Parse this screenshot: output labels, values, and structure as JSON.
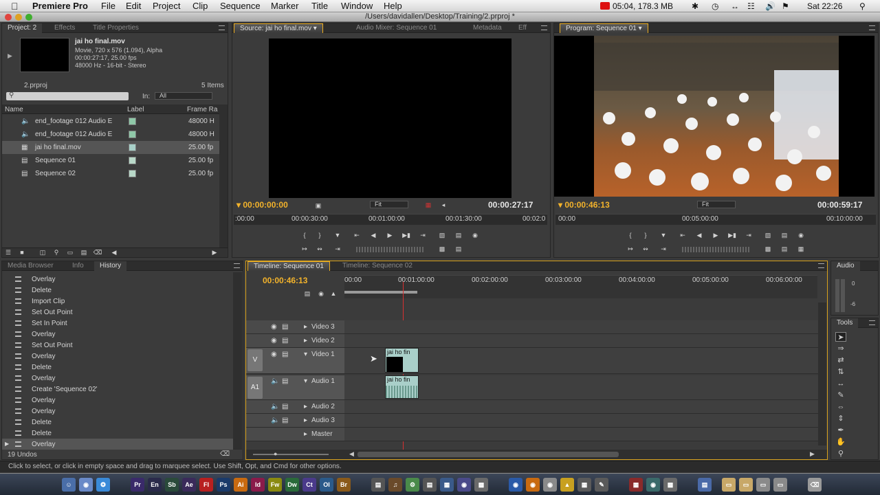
{
  "menubar": {
    "app": "Premiere Pro",
    "items": [
      "File",
      "Edit",
      "Project",
      "Clip",
      "Sequence",
      "Marker",
      "Title",
      "Window",
      "Help"
    ],
    "record_status": "05:04, 178.3 MB",
    "clock": "Sat 22:26"
  },
  "window": {
    "title": "/Users/davidallen/Desktop/Training/2.prproj *"
  },
  "project_panel": {
    "tabs": [
      "Project: 2",
      "Effects",
      "Title Properties"
    ],
    "clip_name": "jai ho final.mov",
    "clip_info": [
      "Movie, 720 x 576 (1.094), Alpha",
      "00:00:27:17, 25.00 fps",
      "48000 Hz - 16-bit - Stereo"
    ],
    "project_file": "2.prproj",
    "item_count": "5 Items",
    "in_label": "In:",
    "in_value": "All",
    "columns": [
      "Name",
      "Label",
      "Frame Ra"
    ],
    "items": [
      {
        "name": "end_footage 012 Audio E",
        "label_color": "#8fc8a8",
        "rate": "48000 H"
      },
      {
        "name": "end_footage 012 Audio E",
        "label_color": "#8fc8a8",
        "rate": "48000 H"
      },
      {
        "name": "jai ho final.mov",
        "label_color": "#a8d0c8",
        "rate": "25.00 fp"
      },
      {
        "name": "Sequence 01",
        "label_color": "#b8d8c8",
        "rate": "25.00 fp"
      },
      {
        "name": "Sequence 02",
        "label_color": "#b8d8c8",
        "rate": "25.00 fp"
      }
    ]
  },
  "source_monitor": {
    "tabs": [
      "Source: jai ho final.mov",
      "Audio Mixer: Sequence 01",
      "Metadata",
      "Eff"
    ],
    "timecode_in": "00:00:00:00",
    "zoom": "Fit",
    "duration": "00:00:27:17",
    "ruler": [
      ":00:00",
      "00:00:30:00",
      "00:01:00:00",
      "00:01:30:00",
      "00:02:0"
    ]
  },
  "program_monitor": {
    "tabs": [
      "Program: Sequence 01"
    ],
    "timecode_in": "00:00:46:13",
    "zoom": "Fit",
    "duration": "00:00:59:17",
    "ruler": [
      "00:00",
      "00:05:00:00",
      "00:10:00:00"
    ]
  },
  "history_panel": {
    "tabs": [
      "Media Browser",
      "Info",
      "History"
    ],
    "items": [
      "Overlay",
      "Delete",
      "Import Clip",
      "Set Out Point",
      "Set In Point",
      "Overlay",
      "Set Out Point",
      "Overlay",
      "Delete",
      "Overlay",
      "Create 'Sequence 02'",
      "Overlay",
      "Overlay",
      "Delete",
      "Delete",
      "Overlay"
    ],
    "undo_count": "19 Undos"
  },
  "timeline": {
    "tabs": [
      "Timeline: Sequence 01",
      "Timeline: Sequence 02"
    ],
    "timecode": "00:00:46:13",
    "ruler": [
      "00:00",
      "00:01:00:00",
      "00:02:00:00",
      "00:03:00:00",
      "00:04:00:00",
      "00:05:00:00",
      "00:06:00:00"
    ],
    "video_tracks": [
      "Video 3",
      "Video 2",
      "Video 1"
    ],
    "audio_tracks": [
      "Audio 1",
      "Audio 2",
      "Audio 3",
      "Master"
    ],
    "target_video": "V",
    "target_audio": "A1",
    "clip_label": "jai ho fin"
  },
  "audio_meters": {
    "tab": "Audio",
    "scale_top": "0",
    "scale_mid": "-6"
  },
  "tools_panel": {
    "tab": "Tools"
  },
  "status_bar": {
    "text": "Click to select, or click in empty space and drag to marquee select. Use Shift, Opt, and Cmd for other options."
  },
  "dock": {
    "apps": [
      "Pr",
      "En",
      "Sb",
      "Ae",
      "Fl",
      "Ps",
      "Ai",
      "Id",
      "Fw",
      "Dw",
      "Ct",
      "Ol",
      "Br"
    ]
  }
}
